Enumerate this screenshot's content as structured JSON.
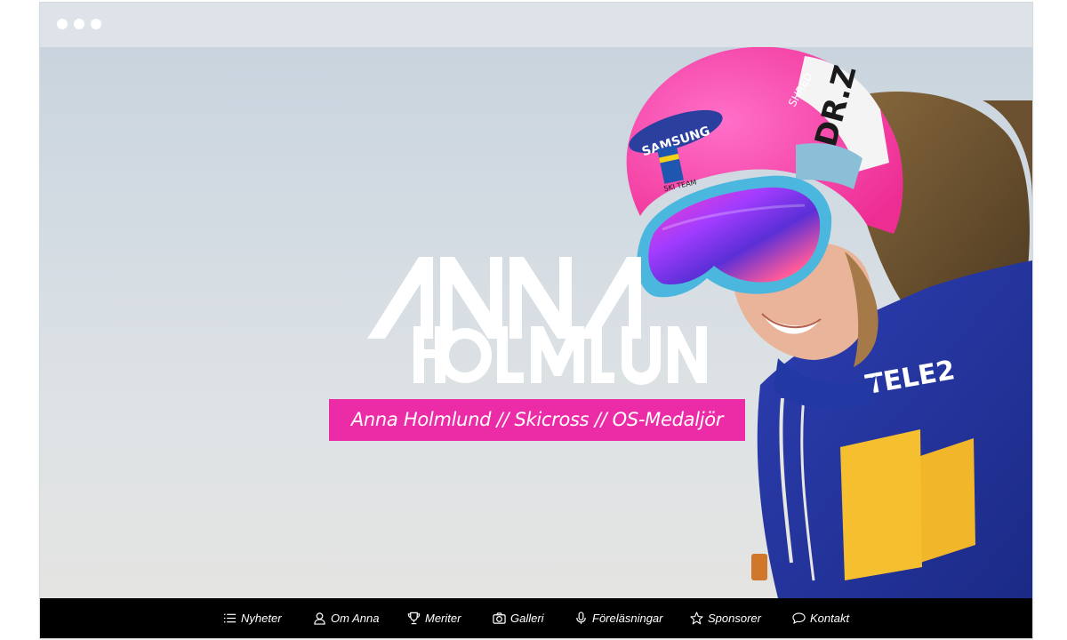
{
  "window": {
    "controls": [
      "window-dot-1",
      "window-dot-2",
      "window-dot-3"
    ]
  },
  "hero": {
    "logo_text_line1": "ANNA",
    "logo_text_line2": "HOLMLUND",
    "tagline": "Anna Holmlund // Skicross // OS-Medaljör",
    "photo_text": {
      "helmet_brand": "SAMSUNG",
      "helmet_team": "SKI TEAM",
      "helmet_side": "SHRED",
      "jacket_brand": "TELE2"
    }
  },
  "nav": {
    "items": [
      {
        "label": "Nyheter",
        "icon": "list-icon"
      },
      {
        "label": "Om Anna",
        "icon": "user-icon"
      },
      {
        "label": "Meriter",
        "icon": "trophy-icon"
      },
      {
        "label": "Galleri",
        "icon": "camera-icon"
      },
      {
        "label": "Föreläsningar",
        "icon": "microphone-icon"
      },
      {
        "label": "Sponsorer",
        "icon": "star-icon"
      },
      {
        "label": "Kontakt",
        "icon": "speech-bubble-icon"
      }
    ]
  },
  "colors": {
    "accent_pink": "#ec2ca6",
    "nav_background": "#000000",
    "chrome": "#dde3e9"
  }
}
